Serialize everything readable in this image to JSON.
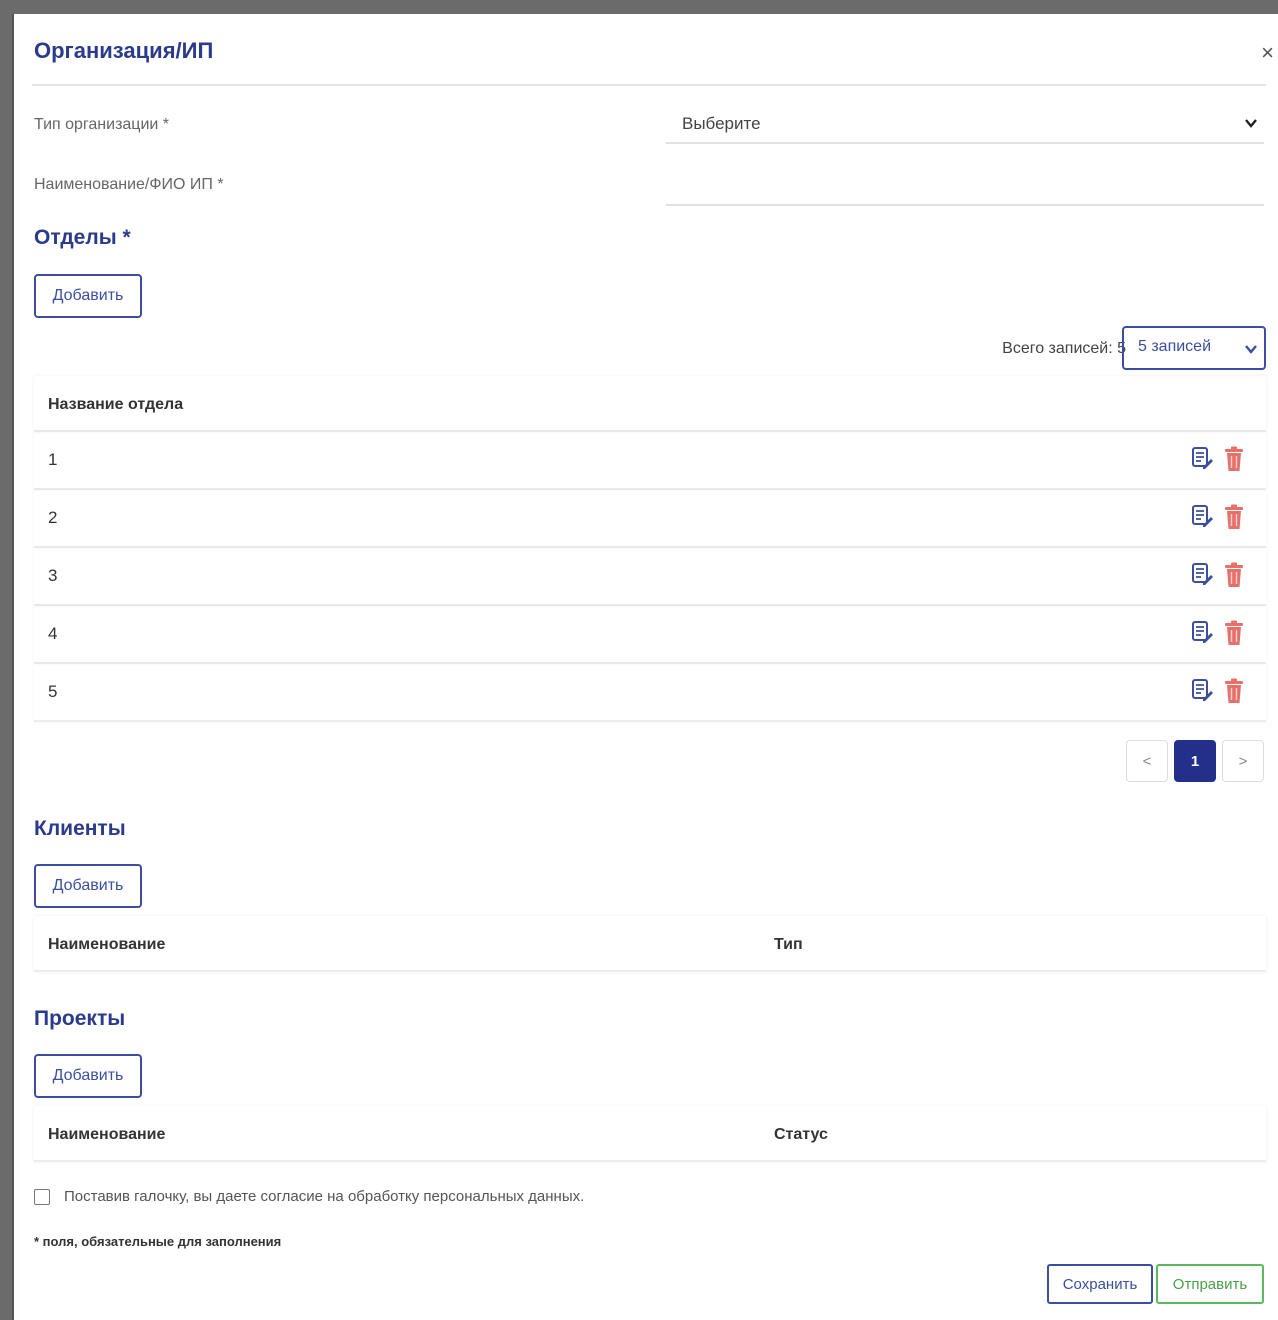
{
  "modal": {
    "title": "Организация/ИП",
    "close_label": "×"
  },
  "form": {
    "org_type_label": "Тип организации *",
    "org_type_value": "Выберите",
    "name_label": "Наименование/ФИО ИП *",
    "name_value": ""
  },
  "departments": {
    "title": "Отделы *",
    "add_label": "Добавить",
    "total_label": "Всего записей: 5",
    "page_size": "5 записей",
    "column_header": "Название отдела",
    "rows": [
      "1",
      "2",
      "3",
      "4",
      "5"
    ],
    "pagination": {
      "prev": "<",
      "current": "1",
      "next": ">"
    }
  },
  "clients": {
    "title": "Клиенты",
    "add_label": "Добавить",
    "columns": [
      "Наименование",
      "Тип"
    ]
  },
  "projects": {
    "title": "Проекты",
    "add_label": "Добавить",
    "columns": [
      "Наименование",
      "Статус"
    ]
  },
  "consent": {
    "text": "Поставив галочку, вы даете согласие на обработку персональных данных.",
    "checked": false
  },
  "required_note": "* поля, обязательные для заполнения",
  "footer": {
    "save_label": "Сохранить",
    "send_label": "Отправить"
  },
  "icons": {
    "edit": "edit-document-icon",
    "delete": "trash-icon"
  },
  "colors": {
    "accent": "#2b3a8c",
    "button_border": "#3c4ea0",
    "active_page": "#22308a",
    "delete": "#e8706a",
    "send": "#5cb85c"
  }
}
